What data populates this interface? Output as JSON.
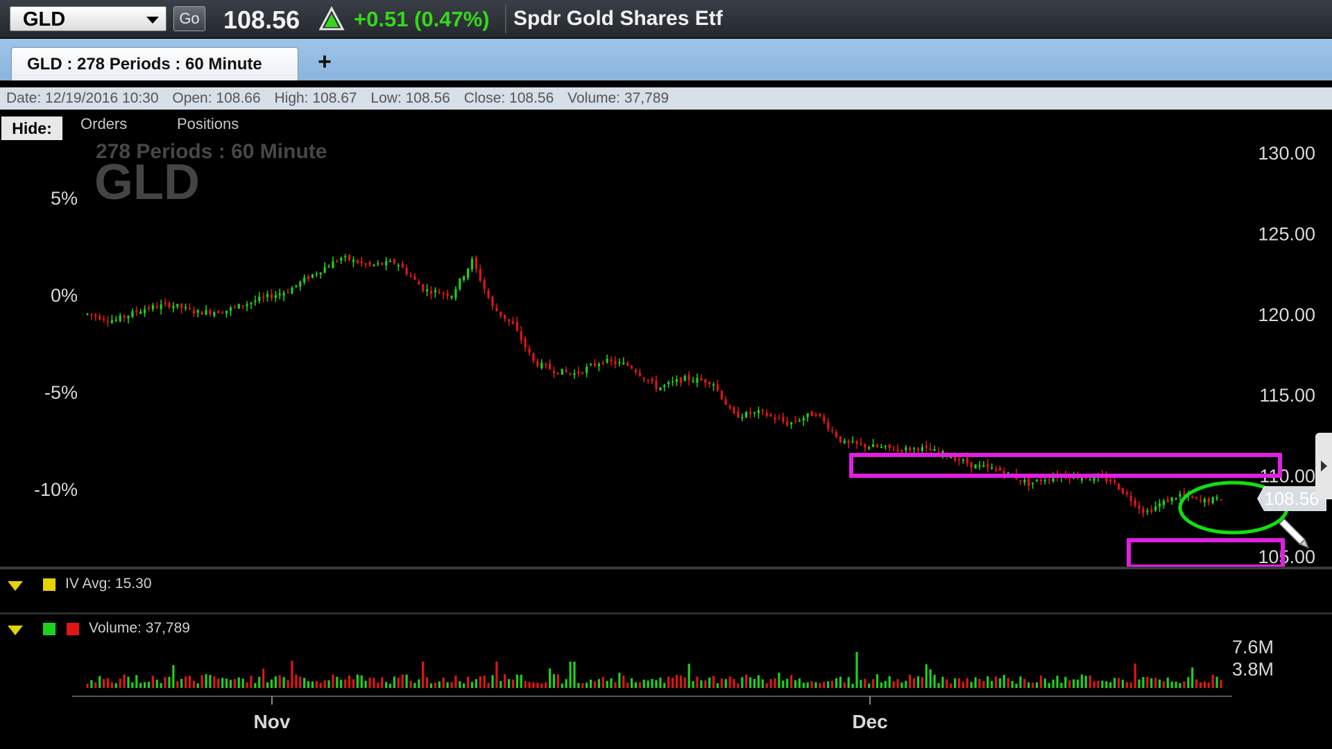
{
  "quote_bar": {
    "symbol": "GLD",
    "go_label": "Go",
    "last_price": "108.56",
    "change": "+0.51 (0.47%)",
    "company_name": "Spdr Gold Shares Etf"
  },
  "tabs": [
    {
      "label": "GLD : 278  Periods : 60 Minute"
    }
  ],
  "add_tab_label": "+",
  "info_row": {
    "date": "Date: 12/19/2016 10:30",
    "open": "Open: 108.66",
    "high": "High: 108.67",
    "low": "Low: 108.56",
    "close": "Close: 108.56",
    "volume": "Volume: 37,789"
  },
  "toolbar": {
    "hide_label": "Hide:",
    "orders_label": "Orders",
    "positions_label": "Positions"
  },
  "watermark": {
    "periods": "278  Periods : 60 Minute",
    "symbol": "GLD"
  },
  "price_tag": "108.56",
  "panes": {
    "iv": {
      "label": "IV Avg: 15.30"
    },
    "volume": {
      "label": "Volume: 37,789"
    }
  },
  "colors": {
    "up": "#1fd11f",
    "down": "#e01616",
    "highlight_box": "#e020e0",
    "highlight_ellipse": "#10e010",
    "iv_swatch": "#e6d400"
  },
  "chart_data": {
    "type": "candlestick",
    "interval": "60 Minute",
    "periods": 278,
    "x_ticks": [
      "Nov",
      "Dec"
    ],
    "y_price_ticks": [
      "130.00",
      "125.00",
      "120.00",
      "115.00",
      "110.00",
      "105.00"
    ],
    "y_percent_ticks": [
      "5%",
      "0%",
      "-5%",
      "-10%"
    ],
    "ylim": [
      104,
      131
    ],
    "close_path": [
      [
        0,
        120.0
      ],
      [
        8,
        119.6
      ],
      [
        16,
        120.3
      ],
      [
        24,
        120.6
      ],
      [
        32,
        120.1
      ],
      [
        40,
        120.2
      ],
      [
        50,
        120.9
      ],
      [
        58,
        121.4
      ],
      [
        66,
        122.5
      ],
      [
        74,
        123.5
      ],
      [
        82,
        123.0
      ],
      [
        90,
        123.2
      ],
      [
        98,
        121.5
      ],
      [
        106,
        121.2
      ],
      [
        112,
        123.3
      ],
      [
        118,
        120.4
      ],
      [
        124,
        119.3
      ],
      [
        130,
        117.0
      ],
      [
        136,
        116.5
      ],
      [
        142,
        116.3
      ],
      [
        150,
        117.1
      ],
      [
        158,
        116.8
      ],
      [
        166,
        115.4
      ],
      [
        174,
        116.0
      ],
      [
        182,
        115.8
      ],
      [
        188,
        113.7
      ],
      [
        196,
        113.9
      ],
      [
        204,
        113.2
      ],
      [
        212,
        113.9
      ],
      [
        220,
        112.0
      ],
      [
        228,
        111.8
      ],
      [
        236,
        111.6
      ],
      [
        242,
        111.7
      ],
      [
        250,
        111.3
      ],
      [
        258,
        110.6
      ],
      [
        266,
        110.3
      ],
      [
        274,
        109.5
      ],
      [
        282,
        110.0
      ],
      [
        290,
        109.9
      ],
      [
        298,
        109.7
      ],
      [
        304,
        108.5
      ],
      [
        308,
        107.7
      ],
      [
        312,
        108.2
      ],
      [
        318,
        108.8
      ],
      [
        324,
        108.4
      ],
      [
        330,
        108.56
      ]
    ],
    "volume_scale": [
      "7.6M",
      "3.8M"
    ],
    "annotations": [
      {
        "shape": "rectangle",
        "color": "magenta",
        "price_range": [
          109.7,
          110.5
        ]
      },
      {
        "shape": "rectangle",
        "color": "magenta",
        "price_range": [
          104.9,
          106.5
        ]
      },
      {
        "shape": "ellipse",
        "color": "green",
        "around": "last price 108.56"
      }
    ]
  }
}
